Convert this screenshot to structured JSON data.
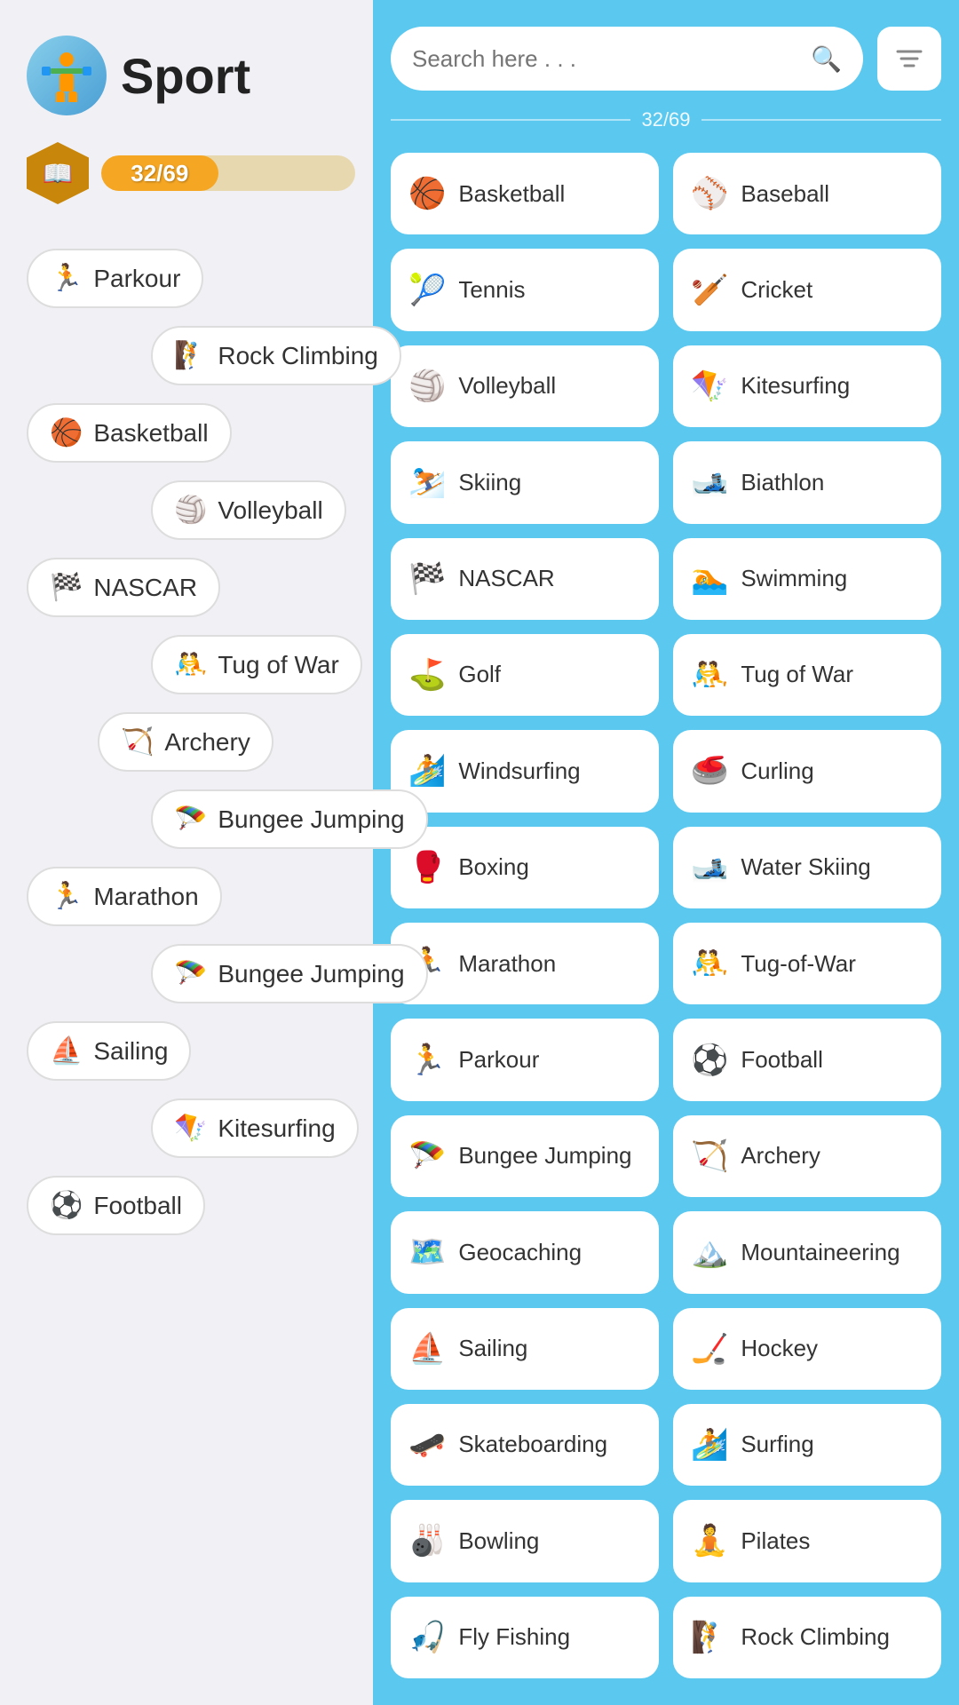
{
  "left": {
    "title": "Sport",
    "logo_emoji": "🏋️",
    "progress": {
      "value": "32/69",
      "fill_pct": "46%"
    },
    "badge_icon": "📖",
    "chips": [
      {
        "icon": "🏃",
        "label": "Parkour",
        "col": "left"
      },
      {
        "icon": "🧗",
        "label": "Rock Climbing",
        "col": "right"
      },
      {
        "icon": "🏀",
        "label": "Basketball",
        "col": "left"
      },
      {
        "icon": "🏐",
        "label": "Volleyball",
        "col": "right"
      },
      {
        "icon": "🏁",
        "label": "NASCAR",
        "col": "left"
      },
      {
        "icon": "🤼",
        "label": "Tug of War",
        "col": "right"
      },
      {
        "icon": "🏹",
        "label": "Archery",
        "col": "right-shift"
      },
      {
        "icon": "🪂",
        "label": "Bungee Jumping",
        "col": "right"
      },
      {
        "icon": "🏃",
        "label": "Marathon",
        "col": "left"
      },
      {
        "icon": "🪂",
        "label": "Bungee Jumping",
        "col": "right"
      },
      {
        "icon": "⛵",
        "label": "Sailing",
        "col": "left"
      },
      {
        "icon": "🪁",
        "label": "Kitesurfing",
        "col": "right"
      },
      {
        "icon": "⚽",
        "label": "Football",
        "col": "left"
      }
    ]
  },
  "right": {
    "search_placeholder": "Search here . . .",
    "count_label": "32/69",
    "items": [
      {
        "icon": "🏀",
        "label": "Basketball"
      },
      {
        "icon": "⚾",
        "label": "Baseball"
      },
      {
        "icon": "🎾",
        "label": "Tennis"
      },
      {
        "icon": "🏏",
        "label": "Cricket"
      },
      {
        "icon": "🏐",
        "label": "Volleyball"
      },
      {
        "icon": "🪁",
        "label": "Kitesurfing"
      },
      {
        "icon": "⛷️",
        "label": "Skiing"
      },
      {
        "icon": "🎿",
        "label": "Biathlon"
      },
      {
        "icon": "🏁",
        "label": "NASCAR"
      },
      {
        "icon": "🏊",
        "label": "Swimming"
      },
      {
        "icon": "⛳",
        "label": "Golf"
      },
      {
        "icon": "🤼",
        "label": "Tug of War"
      },
      {
        "icon": "🏄",
        "label": "Windsurfing"
      },
      {
        "icon": "🥌",
        "label": "Curling"
      },
      {
        "icon": "🥊",
        "label": "Boxing"
      },
      {
        "icon": "🎿",
        "label": "Water Skiing"
      },
      {
        "icon": "🏃",
        "label": "Marathon"
      },
      {
        "icon": "🤼",
        "label": "Tug-of-War"
      },
      {
        "icon": "🏃",
        "label": "Parkour"
      },
      {
        "icon": "⚽",
        "label": "Football"
      },
      {
        "icon": "🪂",
        "label": "Bungee Jumping"
      },
      {
        "icon": "🏹",
        "label": "Archery"
      },
      {
        "icon": "🗺️",
        "label": "Geocaching"
      },
      {
        "icon": "🏔️",
        "label": "Mountaineering"
      },
      {
        "icon": "⛵",
        "label": "Sailing"
      },
      {
        "icon": "🏒",
        "label": "Hockey"
      },
      {
        "icon": "🛹",
        "label": "Skateboarding"
      },
      {
        "icon": "🏄",
        "label": "Surfing"
      },
      {
        "icon": "🎳",
        "label": "Bowling"
      },
      {
        "icon": "🧘",
        "label": "Pilates"
      },
      {
        "icon": "🎣",
        "label": "Fly Fishing"
      },
      {
        "icon": "🧗",
        "label": "Rock Climbing"
      }
    ]
  }
}
